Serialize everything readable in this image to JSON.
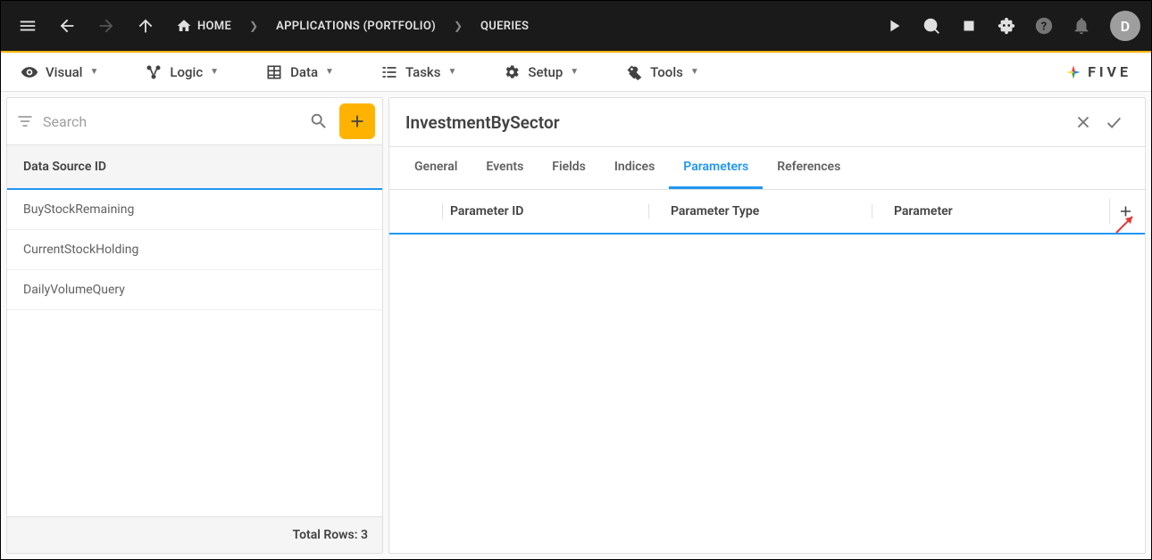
{
  "header": {
    "breadcrumbs": {
      "home": "HOME",
      "mid": "APPLICATIONS (PORTFOLIO)",
      "leaf": "QUERIES"
    },
    "avatar_initial": "D"
  },
  "menubar": {
    "items": [
      {
        "label": "Visual"
      },
      {
        "label": "Logic"
      },
      {
        "label": "Data"
      },
      {
        "label": "Tasks"
      },
      {
        "label": "Setup"
      },
      {
        "label": "Tools"
      }
    ],
    "brand": "FIVE"
  },
  "left": {
    "search_placeholder": "Search",
    "column_header": "Data Source ID",
    "rows": [
      "BuyStockRemaining",
      "CurrentStockHolding",
      "DailyVolumeQuery"
    ],
    "footer": "Total Rows: 3"
  },
  "right": {
    "title": "InvestmentBySector",
    "tabs": [
      {
        "label": "General",
        "active": false
      },
      {
        "label": "Events",
        "active": false
      },
      {
        "label": "Fields",
        "active": false
      },
      {
        "label": "Indices",
        "active": false
      },
      {
        "label": "Parameters",
        "active": true
      },
      {
        "label": "References",
        "active": false
      }
    ],
    "param_columns": {
      "c1": "Parameter ID",
      "c2": "Parameter Type",
      "c3": "Parameter"
    }
  }
}
